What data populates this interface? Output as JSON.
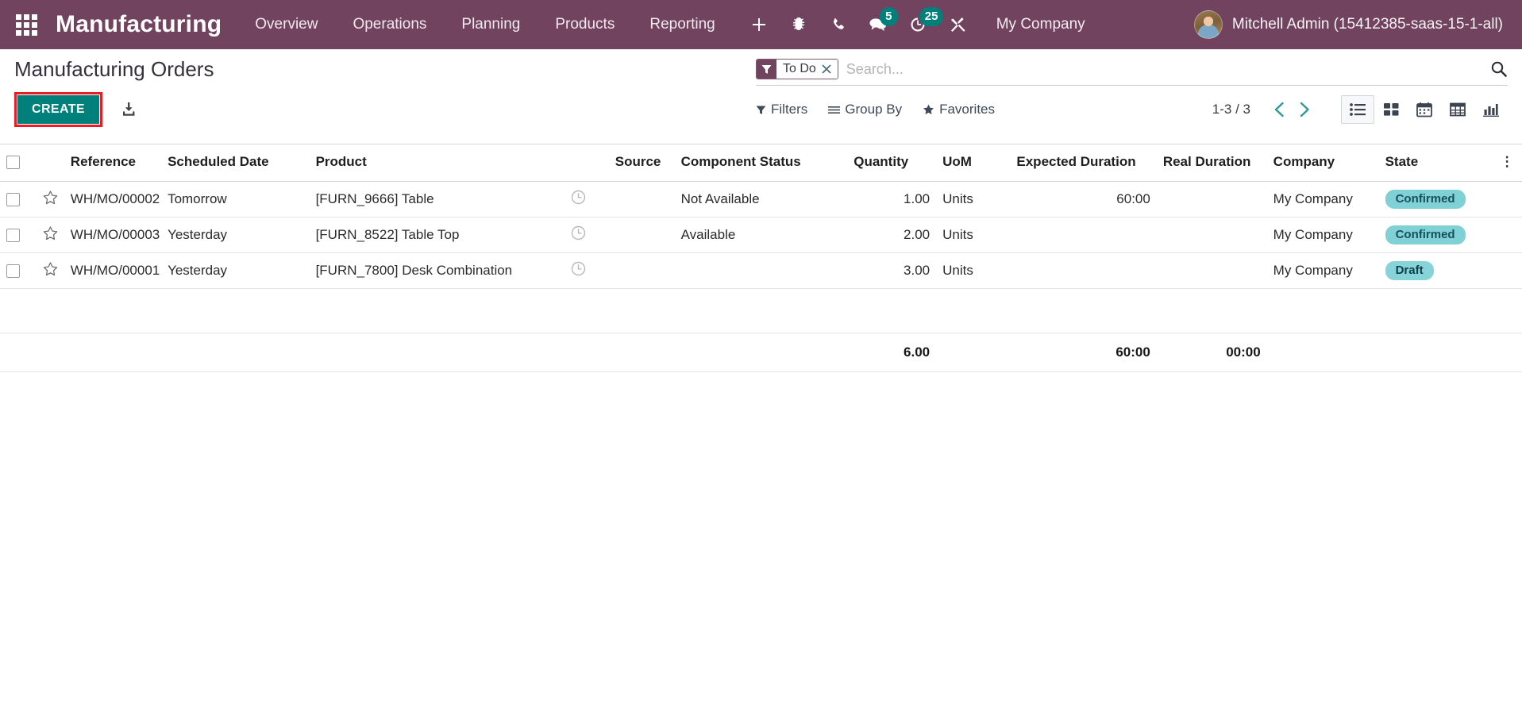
{
  "navbar": {
    "apps_icon": "apps-grid-icon",
    "brand": "Manufacturing",
    "menu_items": [
      {
        "label": "Overview"
      },
      {
        "label": "Operations"
      },
      {
        "label": "Planning"
      },
      {
        "label": "Products"
      },
      {
        "label": "Reporting"
      }
    ],
    "icons": [
      {
        "name": "plus-icon",
        "badge": ""
      },
      {
        "name": "bug-icon",
        "badge": ""
      },
      {
        "name": "phone-icon",
        "badge": ""
      },
      {
        "name": "chat-bubble-icon",
        "badge": "5"
      },
      {
        "name": "activity-clock-icon",
        "badge": "25"
      },
      {
        "name": "tools-icon",
        "badge": ""
      }
    ],
    "messages_badge": "5",
    "activities_badge": "25",
    "company": "My Company",
    "user": "Mitchell Admin (15412385-saas-15-1-all)",
    "background_color": "#71435f",
    "badge_color": "#00807b"
  },
  "control_panel": {
    "title": "Manufacturing Orders",
    "create_label": "CREATE",
    "create_color": "#00807b",
    "highlight_color": "#ee1b24",
    "import_icon": "import-download-icon",
    "search": {
      "facet_label": "To Do",
      "facet_icon": "filter-funnel-icon",
      "facet_remove": "×",
      "placeholder": "Search...",
      "value": "",
      "search_icon": "search-icon"
    },
    "dropdowns": [
      {
        "label": "Filters",
        "icon": "funnel-icon"
      },
      {
        "label": "Group By",
        "icon": "list-lines-icon"
      },
      {
        "label": "Favorites",
        "icon": "star-icon"
      }
    ],
    "pager": {
      "text": "1-3 / 3",
      "prev_icon": "chevron-left-icon",
      "next_icon": "chevron-right-icon"
    },
    "views": [
      {
        "name": "list",
        "icon": "list-view-icon",
        "active": true
      },
      {
        "name": "kanban",
        "icon": "kanban-view-icon",
        "active": false
      },
      {
        "name": "calendar",
        "icon": "calendar-view-icon",
        "active": false
      },
      {
        "name": "pivot",
        "icon": "pivot-view-icon",
        "active": false
      },
      {
        "name": "graph",
        "icon": "graph-view-icon",
        "active": false
      }
    ]
  },
  "list": {
    "columns": {
      "reference": "Reference",
      "scheduled_date": "Scheduled Date",
      "product": "Product",
      "source": "Source",
      "component_status": "Component Status",
      "quantity": "Quantity",
      "uom": "UoM",
      "expected_duration": "Expected Duration",
      "real_duration": "Real Duration",
      "company": "Company",
      "state": "State"
    },
    "rows": [
      {
        "reference": "WH/MO/00002",
        "scheduled_date": "Tomorrow",
        "date_style": "normal",
        "product": "[FURN_9666] Table",
        "source": "",
        "component_status": "Not Available",
        "component_style": "red",
        "quantity": "1.00",
        "uom": "Units",
        "expected_duration": "60:00",
        "real_duration": "",
        "company": "My Company",
        "state": "Confirmed",
        "row_style": "normal"
      },
      {
        "reference": "WH/MO/00003",
        "scheduled_date": "Yesterday",
        "date_style": "red",
        "product": "[FURN_8522] Table Top",
        "source": "",
        "component_status": "Available",
        "component_style": "green",
        "quantity": "2.00",
        "uom": "Units",
        "expected_duration": "",
        "real_duration": "",
        "company": "My Company",
        "state": "Confirmed",
        "row_style": "normal"
      },
      {
        "reference": "WH/MO/00001",
        "scheduled_date": "Yesterday",
        "date_style": "red",
        "product": "[FURN_7800] Desk Combination",
        "source": "",
        "component_status": "",
        "component_style": "none",
        "quantity": "3.00",
        "uom": "Units",
        "expected_duration": "",
        "real_duration": "",
        "company": "My Company",
        "state": "Draft",
        "row_style": "link"
      }
    ],
    "totals": {
      "quantity": "6.00",
      "expected_duration": "60:00",
      "real_duration": "00:00"
    }
  }
}
